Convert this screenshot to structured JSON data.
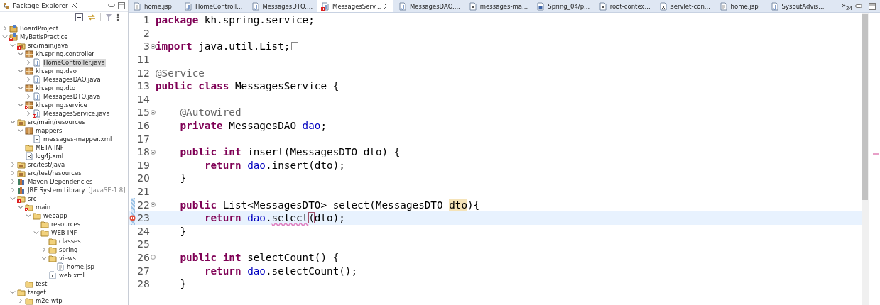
{
  "package_explorer": {
    "title": "Package Explorer",
    "tree": [
      {
        "label": "BoardProject",
        "kind": "project",
        "expanded": false,
        "error": false,
        "selected": false
      },
      {
        "label": "MyBatisPractice",
        "kind": "project",
        "expanded": true,
        "error": true,
        "selected": false,
        "children": [
          {
            "label": "src/main/java",
            "kind": "source-folder",
            "expanded": true,
            "error": true,
            "selected": false,
            "children": [
              {
                "label": "kh.spring.controller",
                "kind": "package",
                "expanded": true,
                "error": false,
                "selected": false,
                "children": [
                  {
                    "label": "HomeController.java",
                    "kind": "java",
                    "expanded": false,
                    "error": false,
                    "selected": true
                  }
                ]
              },
              {
                "label": "kh.spring.dao",
                "kind": "package",
                "expanded": true,
                "error": false,
                "selected": false,
                "children": [
                  {
                    "label": "MessagesDAO.java",
                    "kind": "java",
                    "expanded": false,
                    "error": false,
                    "selected": false
                  }
                ]
              },
              {
                "label": "kh.spring.dto",
                "kind": "package",
                "expanded": true,
                "error": false,
                "selected": false,
                "children": [
                  {
                    "label": "MessagesDTO.java",
                    "kind": "java",
                    "expanded": false,
                    "error": false,
                    "selected": false
                  }
                ]
              },
              {
                "label": "kh.spring.service",
                "kind": "package",
                "expanded": true,
                "error": true,
                "selected": false,
                "children": [
                  {
                    "label": "MessagesService.java",
                    "kind": "java",
                    "expanded": false,
                    "error": true,
                    "selected": false
                  }
                ]
              }
            ]
          },
          {
            "label": "src/main/resources",
            "kind": "source-folder",
            "expanded": true,
            "error": false,
            "selected": false,
            "children": [
              {
                "label": "mappers",
                "kind": "package",
                "expanded": true,
                "error": false,
                "selected": false,
                "children": [
                  {
                    "label": "messages-mapper.xml",
                    "kind": "xml",
                    "error": false,
                    "selected": false
                  }
                ]
              },
              {
                "label": "META-INF",
                "kind": "folder",
                "error": false,
                "selected": false
              },
              {
                "label": "log4j.xml",
                "kind": "xml",
                "error": false,
                "selected": false
              }
            ]
          },
          {
            "label": "src/test/java",
            "kind": "source-folder",
            "expanded": false,
            "error": false,
            "selected": false
          },
          {
            "label": "src/test/resources",
            "kind": "source-folder",
            "expanded": false,
            "error": false,
            "selected": false
          },
          {
            "label": "Maven Dependencies",
            "kind": "library",
            "expanded": false,
            "error": false,
            "selected": false
          },
          {
            "label": "JRE System Library",
            "decoration": "[JavaSE-1.8]",
            "kind": "library",
            "expanded": false,
            "error": false,
            "selected": false
          },
          {
            "label": "src",
            "kind": "folder",
            "expanded": true,
            "error": true,
            "selected": false,
            "children": [
              {
                "label": "main",
                "kind": "folder",
                "expanded": true,
                "error": true,
                "selected": false,
                "children": [
                  {
                    "label": "webapp",
                    "kind": "folder",
                    "expanded": true,
                    "error": false,
                    "selected": false,
                    "children": [
                      {
                        "label": "resources",
                        "kind": "folder",
                        "error": false,
                        "selected": false
                      },
                      {
                        "label": "WEB-INF",
                        "kind": "folder",
                        "expanded": true,
                        "error": false,
                        "selected": false,
                        "children": [
                          {
                            "label": "classes",
                            "kind": "folder",
                            "error": false,
                            "selected": false
                          },
                          {
                            "label": "spring",
                            "kind": "folder",
                            "expanded": false,
                            "error": false,
                            "selected": false
                          },
                          {
                            "label": "views",
                            "kind": "folder",
                            "expanded": true,
                            "error": false,
                            "selected": false,
                            "children": [
                              {
                                "label": "home.jsp",
                                "kind": "jsp",
                                "error": false,
                                "selected": false
                              }
                            ]
                          },
                          {
                            "label": "web.xml",
                            "kind": "xml",
                            "error": false,
                            "selected": false
                          }
                        ]
                      }
                    ]
                  }
                ]
              },
              {
                "label": "test",
                "kind": "folder",
                "error": false,
                "selected": false
              }
            ]
          },
          {
            "label": "target",
            "kind": "folder",
            "expanded": true,
            "error": false,
            "selected": false,
            "children": [
              {
                "label": "m2e-wtp",
                "kind": "folder",
                "expanded": false,
                "error": false,
                "selected": false
              }
            ]
          }
        ]
      }
    ]
  },
  "editor_tabs": [
    {
      "label": "home.jsp",
      "kind": "jsp",
      "error": false,
      "selected": false
    },
    {
      "label": "HomeControll...",
      "kind": "java",
      "error": false,
      "selected": false
    },
    {
      "label": "MessagesDTO....",
      "kind": "java",
      "error": false,
      "selected": false
    },
    {
      "label": "MessagesServ...",
      "kind": "java",
      "error": true,
      "selected": true
    },
    {
      "label": "MessagesDAO....",
      "kind": "java",
      "error": false,
      "selected": false
    },
    {
      "label": "messages-ma...",
      "kind": "xml",
      "error": false,
      "selected": false
    },
    {
      "label": "Spring_04/p...",
      "kind": "maven",
      "error": false,
      "selected": false
    },
    {
      "label": "root-contex...",
      "kind": "xml",
      "error": false,
      "selected": false
    },
    {
      "label": "servlet-con...",
      "kind": "xml",
      "error": false,
      "selected": false
    },
    {
      "label": "home.jsp",
      "kind": "jsp",
      "error": false,
      "selected": false
    },
    {
      "label": "SysoutAdvis...",
      "kind": "java",
      "error": false,
      "selected": false
    }
  ],
  "hidden_tabs": {
    "mark": "»",
    "count": "24"
  },
  "code_lines": [
    {
      "number": "1",
      "changed": false,
      "current": false,
      "error": false,
      "segments": [
        {
          "kind": "keyword",
          "text": "package"
        },
        {
          "kind": "plain",
          "text": " kh.spring.service;"
        }
      ]
    },
    {
      "number": "2",
      "changed": false,
      "current": false,
      "error": false
    },
    {
      "number": "3",
      "folded": true,
      "changed": false,
      "current": false,
      "error": false,
      "segments": [
        {
          "kind": "keyword",
          "text": "import"
        },
        {
          "kind": "plain",
          "text": " java.util.List;"
        }
      ]
    },
    {
      "number": "11",
      "changed": false,
      "current": false,
      "error": false
    },
    {
      "number": "12",
      "changed": false,
      "current": false,
      "error": false,
      "segments": [
        {
          "kind": "annotation",
          "text": "@Service"
        }
      ]
    },
    {
      "number": "13",
      "changed": false,
      "current": false,
      "error": false,
      "segments": [
        {
          "kind": "keyword",
          "text": "public"
        },
        {
          "kind": "keyword",
          "text": " class"
        },
        {
          "kind": "plain",
          "text": " MessagesService {"
        }
      ]
    },
    {
      "number": "14",
      "changed": false,
      "current": false,
      "error": false
    },
    {
      "number": "15",
      "folded": false,
      "changed": false,
      "current": false,
      "error": false,
      "segments": [
        {
          "kind": "annotation",
          "text": "@Autowired"
        }
      ]
    },
    {
      "number": "16",
      "changed": false,
      "current": false,
      "error": false,
      "segments": [
        {
          "kind": "keyword",
          "text": "private"
        },
        {
          "kind": "plain",
          "text": " MessagesDAO"
        },
        {
          "kind": "field",
          "text": " dao"
        },
        {
          "kind": "plain",
          "text": ";"
        }
      ]
    },
    {
      "number": "17",
      "changed": false,
      "current": false,
      "error": false
    },
    {
      "number": "18",
      "folded": false,
      "changed": false,
      "current": false,
      "error": false,
      "segments": [
        {
          "kind": "keyword",
          "text": "public"
        },
        {
          "kind": "keyword",
          "text": " int"
        },
        {
          "kind": "plain",
          "text": " insert(MessagesDTO dto) {"
        }
      ]
    },
    {
      "number": "19",
      "changed": false,
      "current": false,
      "error": false,
      "segments": [
        {
          "kind": "keyword",
          "text": "return"
        },
        {
          "kind": "field",
          "text": " dao"
        },
        {
          "kind": "plain",
          "text": ".insert(dto);"
        }
      ]
    },
    {
      "number": "20",
      "changed": false,
      "current": false,
      "error": false,
      "segments": [
        {
          "kind": "plain",
          "text": "}"
        }
      ]
    },
    {
      "number": "21",
      "changed": false,
      "current": false,
      "error": false
    },
    {
      "number": "22",
      "folded": false,
      "changed": true,
      "current": false,
      "error": false,
      "segments": [
        {
          "kind": "keyword",
          "text": "public"
        },
        {
          "kind": "plain",
          "text": " List<MessagesDTO> select(MessagesDTO "
        },
        {
          "kind": "occurrence",
          "text": "dto"
        },
        {
          "kind": "plain",
          "text": "){"
        }
      ]
    },
    {
      "number": "23",
      "changed": true,
      "current": true,
      "error": true,
      "segments": [
        {
          "kind": "keyword",
          "text": "return"
        },
        {
          "kind": "field",
          "text": " dao"
        },
        {
          "kind": "plain",
          "text": "."
        },
        {
          "kind": "squiggle",
          "text": "select"
        },
        {
          "kind": "bracket",
          "text": "("
        },
        {
          "kind": "plain",
          "text": "dto);"
        }
      ]
    },
    {
      "number": "24",
      "changed": false,
      "current": false,
      "error": false,
      "segments": [
        {
          "kind": "plain",
          "text": "}"
        }
      ]
    },
    {
      "number": "25",
      "changed": false,
      "current": false,
      "error": false
    },
    {
      "number": "26",
      "folded": false,
      "changed": false,
      "current": false,
      "error": false,
      "segments": [
        {
          "kind": "keyword",
          "text": "public"
        },
        {
          "kind": "keyword",
          "text": " int"
        },
        {
          "kind": "plain",
          "text": " selectCount() {"
        }
      ]
    },
    {
      "number": "27",
      "changed": false,
      "current": false,
      "error": false,
      "segments": [
        {
          "kind": "keyword",
          "text": "return"
        },
        {
          "kind": "field",
          "text": " dao"
        },
        {
          "kind": "plain",
          "text": ".selectCount();"
        }
      ]
    },
    {
      "number": "28",
      "changed": false,
      "current": false,
      "error": false,
      "segments": [
        {
          "kind": "plain",
          "text": "}"
        }
      ]
    }
  ]
}
